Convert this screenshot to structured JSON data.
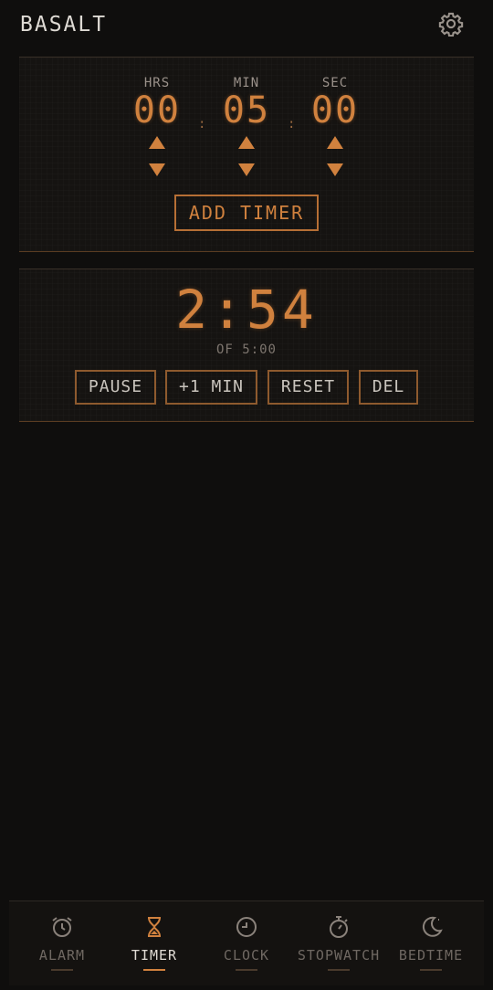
{
  "app": {
    "title": "BASALT"
  },
  "setter": {
    "hours": {
      "label": "HRS",
      "value": "00"
    },
    "minutes": {
      "label": "MIN",
      "value": "05"
    },
    "seconds": {
      "label": "SEC",
      "value": "00"
    },
    "separator": ":",
    "add_label": "ADD TIMER"
  },
  "running_timer": {
    "remaining": "2:54",
    "total_label": "OF 5:00",
    "pause_label": "PAUSE",
    "add_min_label": "+1 MIN",
    "reset_label": "RESET",
    "delete_label": "DEL"
  },
  "nav": {
    "items": [
      {
        "label": "ALARM",
        "icon": "alarm-icon",
        "active": false
      },
      {
        "label": "TIMER",
        "icon": "hourglass-icon",
        "active": true
      },
      {
        "label": "CLOCK",
        "icon": "clock-icon",
        "active": false
      },
      {
        "label": "STOPWATCH",
        "icon": "stopwatch-icon",
        "active": false
      },
      {
        "label": "BEDTIME",
        "icon": "moon-icon",
        "active": false
      }
    ]
  },
  "colors": {
    "accent": "#d0813e",
    "background": "#0f0e0d",
    "panel": "#151311"
  }
}
